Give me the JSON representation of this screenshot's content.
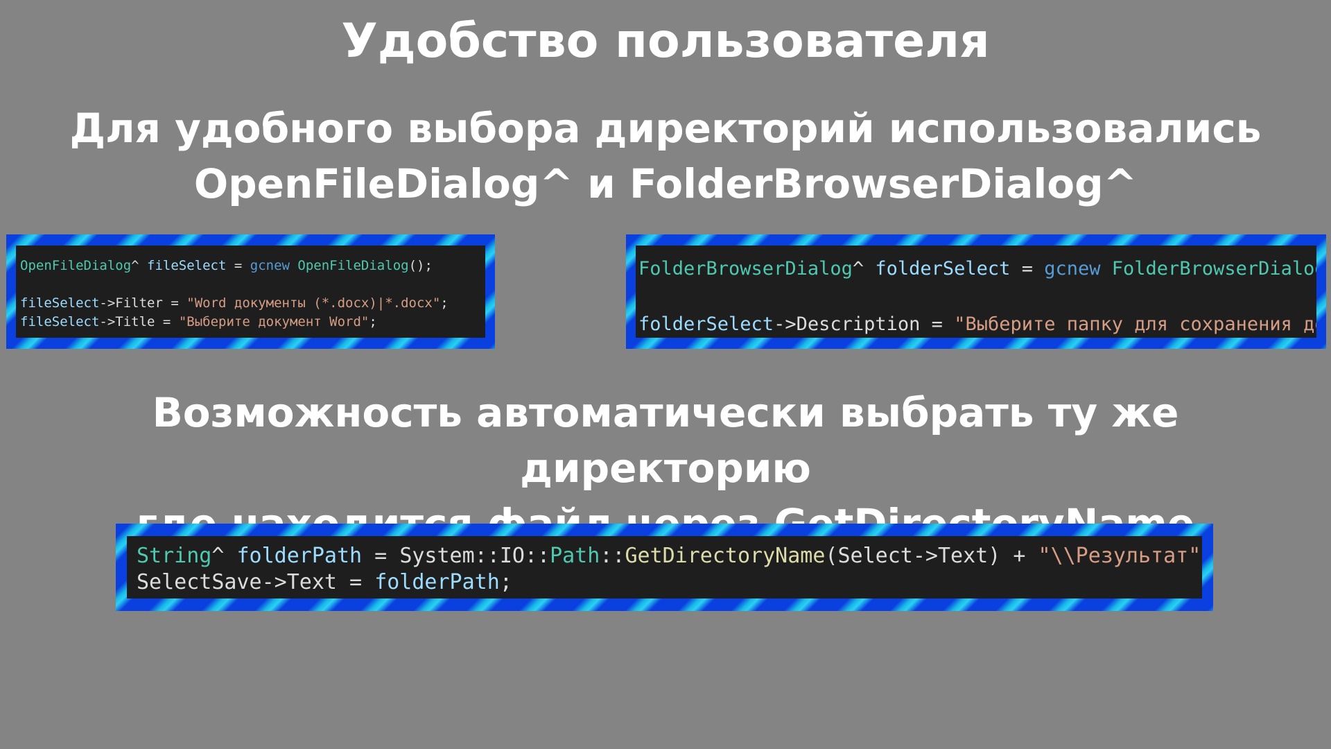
{
  "title": "Удобство пользователя",
  "subtitle_1": {
    "line1": "Для удобного выбора директорий использовались",
    "line2": "OpenFileDialog^ и FolderBrowserDialog^"
  },
  "subtitle_2": {
    "line1": "Возможность автоматически выбрать ту же директорию",
    "line2": "где находится файл через GetDirectoryName"
  },
  "colors": {
    "background": "#848484",
    "heading_text": "#ffffff",
    "frame_blue": "#0a3fe0",
    "frame_cyan": "#2ad0f4",
    "code_bg": "#1e1e1e"
  },
  "code_snippets": [
    {
      "lines": [
        [
          {
            "cls": "t-type",
            "text": "OpenFileDialog"
          },
          {
            "cls": "t-op",
            "text": "^ "
          },
          {
            "cls": "t-var",
            "text": "fileSelect"
          },
          {
            "cls": "t-op",
            "text": " = "
          },
          {
            "cls": "t-kw",
            "text": "gcnew"
          },
          {
            "cls": "t-op",
            "text": " "
          },
          {
            "cls": "t-type",
            "text": "OpenFileDialog"
          },
          {
            "cls": "t-op",
            "text": "();"
          }
        ],
        [],
        [
          {
            "cls": "t-var",
            "text": "fileSelect"
          },
          {
            "cls": "t-op",
            "text": "->"
          },
          {
            "cls": "t-plain",
            "text": "Filter"
          },
          {
            "cls": "t-op",
            "text": " = "
          },
          {
            "cls": "t-str",
            "text": "\"Word документы (*.docx)|*.docx\""
          },
          {
            "cls": "t-op",
            "text": ";"
          }
        ],
        [
          {
            "cls": "t-var",
            "text": "fileSelect"
          },
          {
            "cls": "t-op",
            "text": "->"
          },
          {
            "cls": "t-plain",
            "text": "Title"
          },
          {
            "cls": "t-op",
            "text": " = "
          },
          {
            "cls": "t-str",
            "text": "\"Выберите документ Word\""
          },
          {
            "cls": "t-op",
            "text": ";"
          }
        ]
      ]
    },
    {
      "lines": [
        [
          {
            "cls": "t-type",
            "text": "FolderBrowserDialog"
          },
          {
            "cls": "t-op",
            "text": "^ "
          },
          {
            "cls": "t-var",
            "text": "folderSelect"
          },
          {
            "cls": "t-op",
            "text": " = "
          },
          {
            "cls": "t-kw",
            "text": "gcnew"
          },
          {
            "cls": "t-op",
            "text": " "
          },
          {
            "cls": "t-type",
            "text": "FolderBrowserDialog"
          },
          {
            "cls": "t-op",
            "text": "();"
          }
        ],
        [],
        [
          {
            "cls": "t-var",
            "text": "folderSelect"
          },
          {
            "cls": "t-op",
            "text": "->"
          },
          {
            "cls": "t-plain",
            "text": "Description"
          },
          {
            "cls": "t-op",
            "text": " = "
          },
          {
            "cls": "t-str",
            "text": "\"Выберите папку для сохранения документа\""
          },
          {
            "cls": "t-op",
            "text": ";"
          }
        ]
      ]
    },
    {
      "lines": [
        [
          {
            "cls": "t-type",
            "text": "String"
          },
          {
            "cls": "t-op",
            "text": "^ "
          },
          {
            "cls": "t-var",
            "text": "folderPath"
          },
          {
            "cls": "t-op",
            "text": " = "
          },
          {
            "cls": "t-plain",
            "text": "System"
          },
          {
            "cls": "t-op",
            "text": "::"
          },
          {
            "cls": "t-plain",
            "text": "IO"
          },
          {
            "cls": "t-op",
            "text": "::"
          },
          {
            "cls": "t-type",
            "text": "Path"
          },
          {
            "cls": "t-op",
            "text": "::"
          },
          {
            "cls": "t-fn",
            "text": "GetDirectoryName"
          },
          {
            "cls": "t-op",
            "text": "("
          },
          {
            "cls": "t-plain",
            "text": "Select"
          },
          {
            "cls": "t-op",
            "text": "->"
          },
          {
            "cls": "t-plain",
            "text": "Text"
          },
          {
            "cls": "t-op",
            "text": ") + "
          },
          {
            "cls": "t-str",
            "text": "\"\\\\Результат\""
          },
          {
            "cls": "t-op",
            "text": ";"
          }
        ],
        [
          {
            "cls": "t-plain",
            "text": "SelectSave"
          },
          {
            "cls": "t-op",
            "text": "->"
          },
          {
            "cls": "t-plain",
            "text": "Text"
          },
          {
            "cls": "t-op",
            "text": " = "
          },
          {
            "cls": "t-var",
            "text": "folderPath"
          },
          {
            "cls": "t-op",
            "text": ";"
          }
        ]
      ]
    }
  ]
}
